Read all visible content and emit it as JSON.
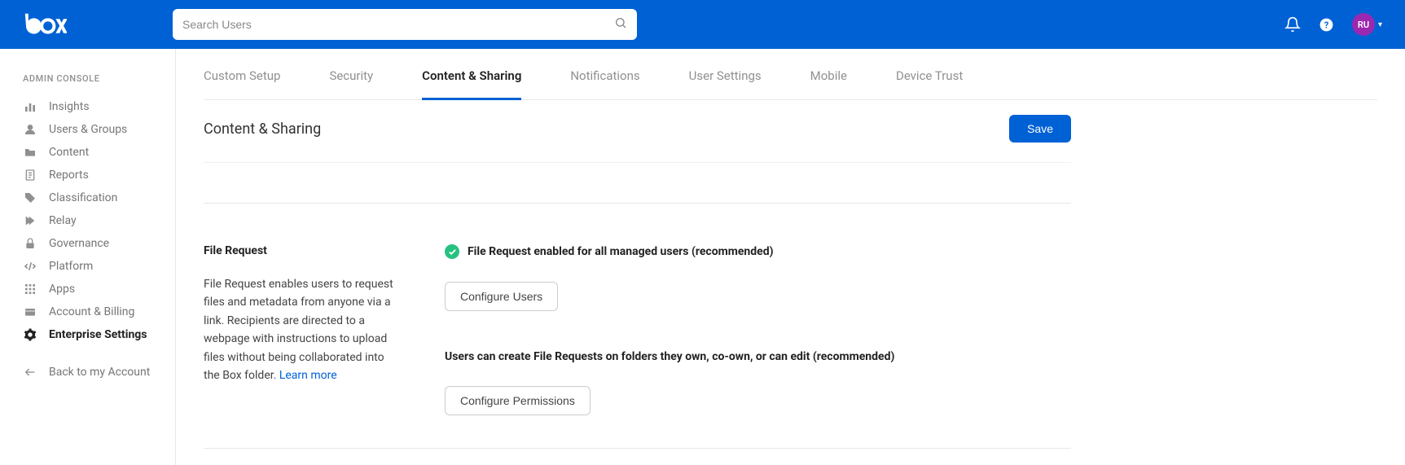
{
  "search": {
    "placeholder": "Search Users"
  },
  "user": {
    "initials": "RU"
  },
  "sidebar": {
    "label": "ADMIN CONSOLE",
    "items": [
      {
        "label": "Insights"
      },
      {
        "label": "Users & Groups"
      },
      {
        "label": "Content"
      },
      {
        "label": "Reports"
      },
      {
        "label": "Classification"
      },
      {
        "label": "Relay"
      },
      {
        "label": "Governance"
      },
      {
        "label": "Platform"
      },
      {
        "label": "Apps"
      },
      {
        "label": "Account & Billing"
      },
      {
        "label": "Enterprise Settings"
      }
    ],
    "back": "Back to my Account"
  },
  "tabs": [
    {
      "label": "Custom Setup"
    },
    {
      "label": "Security"
    },
    {
      "label": "Content & Sharing"
    },
    {
      "label": "Notifications"
    },
    {
      "label": "User Settings"
    },
    {
      "label": "Mobile"
    },
    {
      "label": "Device Trust"
    }
  ],
  "page": {
    "title": "Content & Sharing",
    "save": "Save"
  },
  "fileRequest": {
    "title": "File Request",
    "description": "File Request enables users to request files and metadata from anyone via a link. Recipients are directed to a webpage with instructions to upload files without being collaborated into the Box folder. ",
    "learnMore": "Learn more",
    "enabledStatus": "File Request enabled for all managed users (recommended)",
    "configureUsers": "Configure Users",
    "permissionsTitle": "Users can create File Requests on folders they own, co-own, or can edit (recommended)",
    "configurePermissions": "Configure Permissions"
  }
}
